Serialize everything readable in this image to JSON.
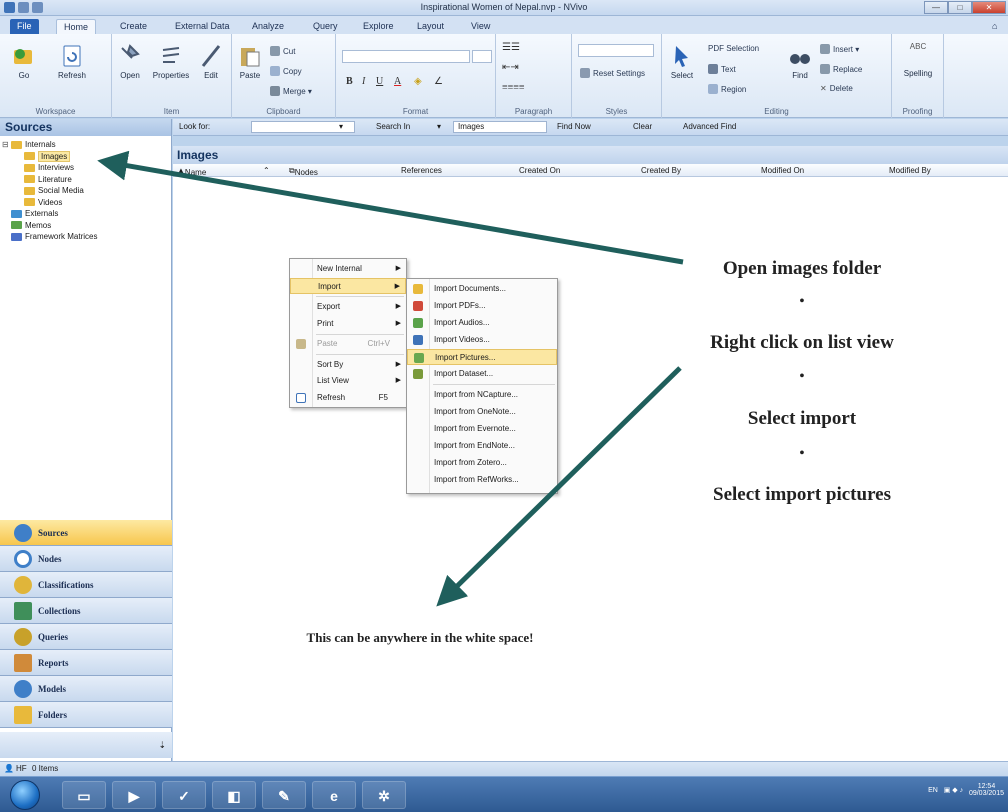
{
  "window": {
    "title": "Inspirational Women of Nepal.nvp - NVivo",
    "min_label": "—",
    "max_label": "□",
    "close_label": "✕"
  },
  "ribbon": {
    "tabs": [
      "File",
      "Home",
      "Create",
      "External Data",
      "Analyze",
      "Query",
      "Explore",
      "Layout",
      "View"
    ],
    "help_label": "⌂",
    "groups": {
      "workspace": {
        "name": "Workspace",
        "go": "Go",
        "refresh": "Refresh"
      },
      "item": {
        "name": "Item",
        "open": "Open",
        "properties": "Properties",
        "edit": "Edit"
      },
      "clipboard": {
        "name": "Clipboard",
        "paste": "Paste",
        "cut": "Cut",
        "copy": "Copy",
        "merge": "Merge"
      },
      "format": {
        "name": "Format",
        "bold": "B",
        "italic": "I",
        "underline": "U",
        "font_color": "A"
      },
      "paragraph": {
        "name": "Paragraph"
      },
      "styles": {
        "name": "Styles",
        "reset": "Reset Settings"
      },
      "editing": {
        "name": "Editing",
        "select": "Select",
        "pdf_selection": "PDF Selection",
        "text": "Text",
        "region": "Region",
        "find": "Find",
        "insert": "Insert",
        "replace": "Replace",
        "delete": "Delete"
      },
      "proofing": {
        "name": "Proofing",
        "spelling": "Spelling",
        "abc": "ABC"
      }
    }
  },
  "navigation": {
    "header": "Sources",
    "tree": [
      {
        "label": "Internals",
        "level": 0,
        "expanded": true
      },
      {
        "label": "Images",
        "level": 1,
        "selected": true
      },
      {
        "label": "Interviews",
        "level": 1
      },
      {
        "label": "Literature",
        "level": 1
      },
      {
        "label": "Social Media",
        "level": 1
      },
      {
        "label": "Videos",
        "level": 1
      },
      {
        "label": "Externals",
        "level": 0
      },
      {
        "label": "Memos",
        "level": 0
      },
      {
        "label": "Framework Matrices",
        "level": 0
      }
    ],
    "buttons": [
      "Sources",
      "Nodes",
      "Classifications",
      "Collections",
      "Queries",
      "Reports",
      "Models",
      "Folders"
    ],
    "more_label": "⇣",
    "splitter_label": "........."
  },
  "findbar": {
    "look_for": "Look for:",
    "search_in": "Search In",
    "search_in_value": "Images",
    "find_now": "Find Now",
    "clear": "Clear",
    "advanced_find": "Advanced Find"
  },
  "list": {
    "title": "Images",
    "columns": [
      "Name",
      "Nodes",
      "References",
      "Created On",
      "Created By",
      "Modified On",
      "Modified By"
    ]
  },
  "context_menu": {
    "items": [
      {
        "label": "New Internal",
        "submenu": true
      },
      {
        "label": "Import",
        "submenu": true,
        "highlighted": true
      },
      {
        "label": "Export",
        "submenu": true
      },
      {
        "label": "Print",
        "submenu": true
      },
      {
        "label": "Paste",
        "shortcut": "Ctrl+V",
        "disabled": true
      },
      {
        "label": "Sort By",
        "submenu": true
      },
      {
        "label": "List View",
        "submenu": true
      },
      {
        "label": "Refresh",
        "shortcut": "F5"
      }
    ]
  },
  "import_menu": {
    "items": [
      "Import Documents...",
      "Import PDFs...",
      "Import Audios...",
      "Import Videos...",
      "Import Pictures...",
      "Import Dataset...",
      "Import from NCapture...",
      "Import from OneNote...",
      "Import from Evernote...",
      "Import from EndNote...",
      "Import from Zotero...",
      "Import from RefWorks..."
    ],
    "highlighted_index": 4
  },
  "annotation": {
    "steps": [
      "Open images  folder",
      "Right click on list view",
      "Select import",
      "Select import pictures"
    ],
    "bullet": "•",
    "note": "This can be anywhere in the white space!",
    "arrow_color": "#1f5f5c"
  },
  "status": {
    "user": "HF",
    "items": "0 Items"
  },
  "taskbar": {
    "lang": "EN",
    "time": "12:54",
    "date": "09/03/2015"
  },
  "colors": {
    "accent": "#2a63b6",
    "highlight": "#fbe7a2",
    "annotation_arrow": "#1f5f5c"
  }
}
